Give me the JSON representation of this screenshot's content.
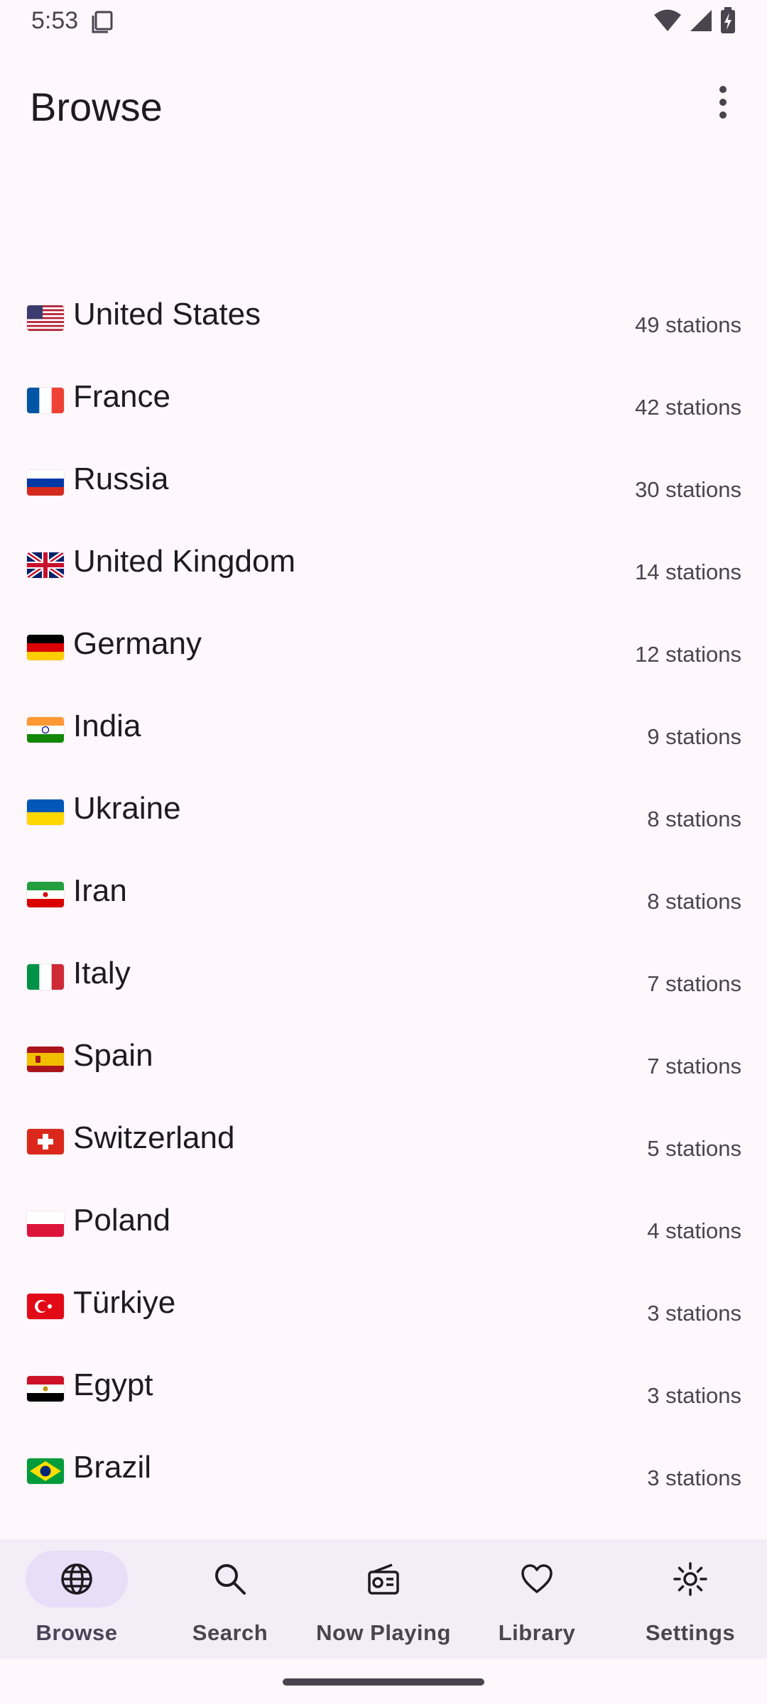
{
  "status_bar": {
    "time": "5:53",
    "icons": [
      "screenshot-icon",
      "wifi-icon",
      "cell-signal-icon",
      "battery-charging-icon"
    ]
  },
  "header": {
    "title": "Browse",
    "menu_icon": "more-vert-icon"
  },
  "countries": [
    {
      "flag": "us",
      "name": "United States",
      "count": "49 stations"
    },
    {
      "flag": "fr",
      "name": "France",
      "count": "42 stations"
    },
    {
      "flag": "ru",
      "name": "Russia",
      "count": "30 stations"
    },
    {
      "flag": "gb",
      "name": "United Kingdom",
      "count": "14 stations"
    },
    {
      "flag": "de",
      "name": "Germany",
      "count": "12 stations"
    },
    {
      "flag": "in",
      "name": "India",
      "count": "9 stations"
    },
    {
      "flag": "ua",
      "name": "Ukraine",
      "count": "8 stations"
    },
    {
      "flag": "ir",
      "name": "Iran",
      "count": "8 stations"
    },
    {
      "flag": "it",
      "name": "Italy",
      "count": "7 stations"
    },
    {
      "flag": "es",
      "name": "Spain",
      "count": "7 stations"
    },
    {
      "flag": "ch",
      "name": "Switzerland",
      "count": "5 stations"
    },
    {
      "flag": "pl",
      "name": "Poland",
      "count": "4 stations"
    },
    {
      "flag": "tr",
      "name": "Türkiye",
      "count": "3 stations"
    },
    {
      "flag": "eg",
      "name": "Egypt",
      "count": "3 stations"
    },
    {
      "flag": "br",
      "name": "Brazil",
      "count": "3 stations"
    }
  ],
  "bottom_nav": {
    "items": [
      {
        "label": "Browse",
        "icon": "globe-icon",
        "active": true
      },
      {
        "label": "Search",
        "icon": "search-icon",
        "active": false
      },
      {
        "label": "Now Playing",
        "icon": "radio-icon",
        "active": false
      },
      {
        "label": "Library",
        "icon": "heart-icon",
        "active": false
      },
      {
        "label": "Settings",
        "icon": "settings-sun-icon",
        "active": false
      }
    ]
  },
  "colors": {
    "background": "#FEF7FC",
    "nav_background": "#F3EDF7",
    "active_indicator": "#E8DEF8",
    "text_primary": "#1D1B20",
    "text_secondary": "#49454F"
  }
}
